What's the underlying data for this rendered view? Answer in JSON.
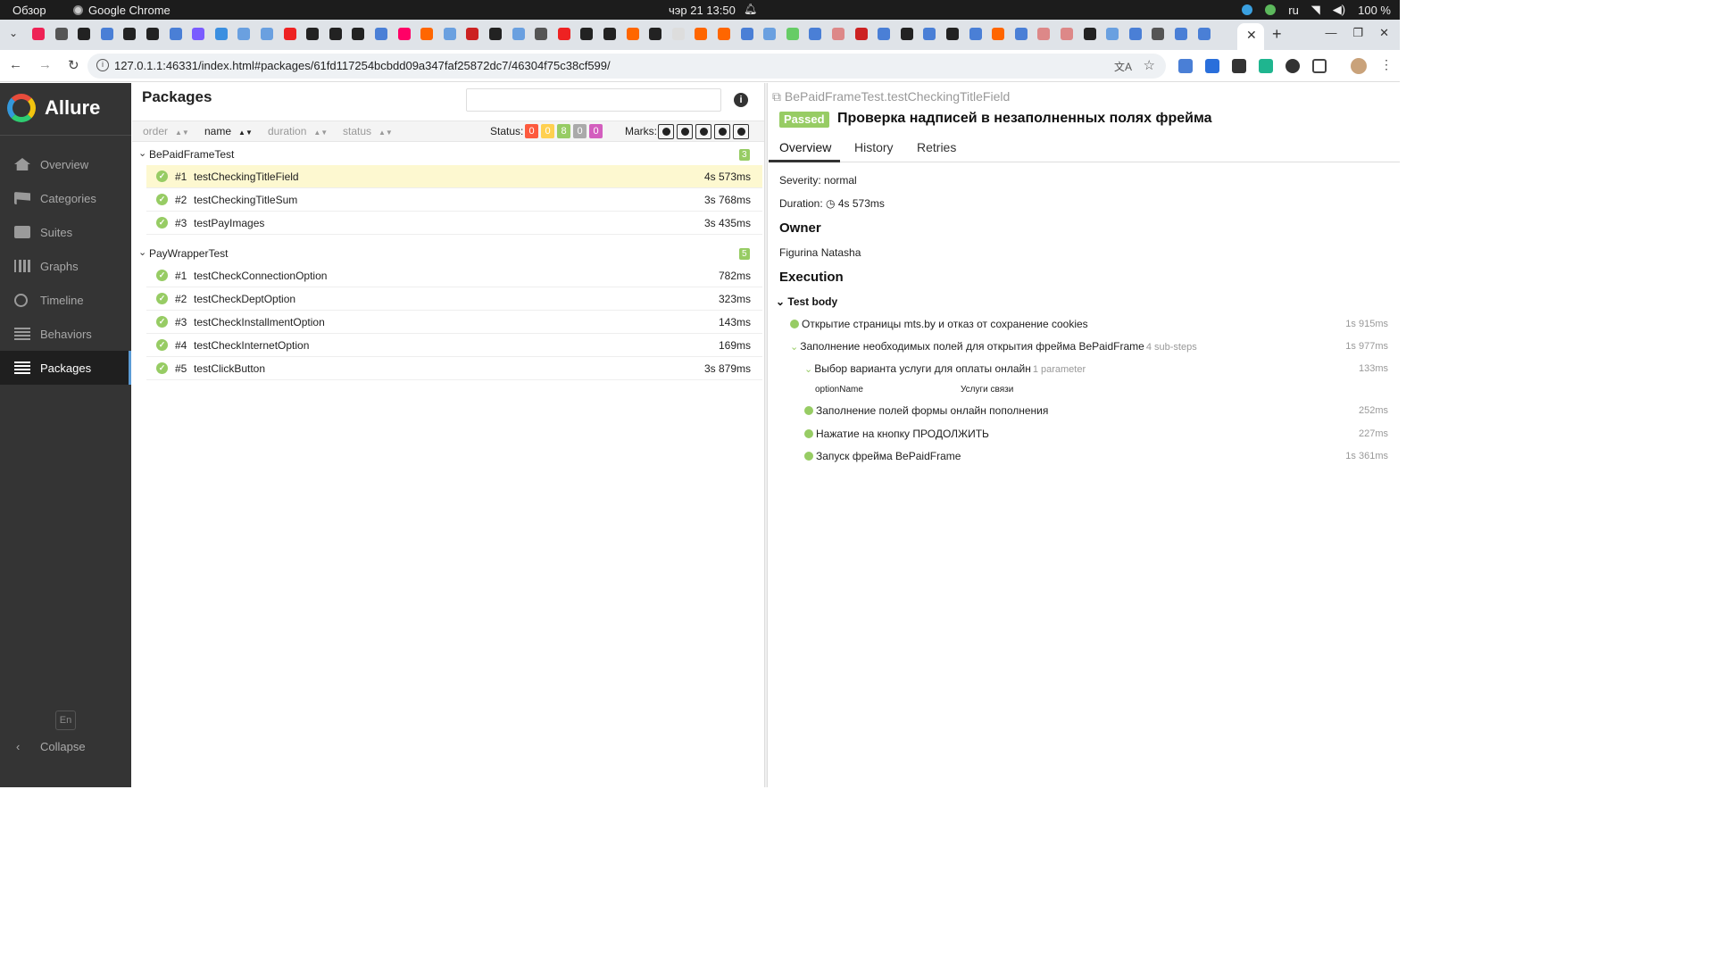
{
  "os": {
    "overview": "Обзор",
    "app_name": "Google Chrome",
    "clock": "чэр 21  13:50",
    "lang": "ru",
    "battery": "100 %"
  },
  "browser": {
    "url": "127.0.1.1:46331/index.html#packages/61fd117254bcbdd09a347faf25872dc7/46304f75c38cf599/"
  },
  "sidebar": {
    "brand": "Allure",
    "items": [
      {
        "label": "Overview",
        "icon": "home-icon"
      },
      {
        "label": "Categories",
        "icon": "flag-icon"
      },
      {
        "label": "Suites",
        "icon": "briefcase-icon"
      },
      {
        "label": "Graphs",
        "icon": "bar-chart-icon"
      },
      {
        "label": "Timeline",
        "icon": "clock-icon"
      },
      {
        "label": "Behaviors",
        "icon": "list-icon"
      },
      {
        "label": "Packages",
        "icon": "align-left-icon",
        "active": true
      }
    ],
    "language": "En",
    "collapse": "Collapse"
  },
  "packages": {
    "title": "Packages",
    "sort": {
      "order": "order",
      "name": "name",
      "duration": "duration",
      "status": "status"
    },
    "status_label": "Status:",
    "status_counts": [
      {
        "value": "0",
        "color": "#fd5a3e"
      },
      {
        "value": "0",
        "color": "#ffd050"
      },
      {
        "value": "8",
        "color": "#97cc64"
      },
      {
        "value": "0",
        "color": "#aaaaaa"
      },
      {
        "value": "0",
        "color": "#d35ebe"
      }
    ],
    "marks_label": "Marks:",
    "groups": [
      {
        "name": "BePaidFrameTest",
        "count": "3",
        "tests": [
          {
            "num": "#1",
            "name": "testCheckingTitleField",
            "duration": "4s 573ms",
            "selected": true
          },
          {
            "num": "#2",
            "name": "testCheckingTitleSum",
            "duration": "3s 768ms"
          },
          {
            "num": "#3",
            "name": "testPayImages",
            "duration": "3s 435ms"
          }
        ]
      },
      {
        "name": "PayWrapperTest",
        "count": "5",
        "tests": [
          {
            "num": "#1",
            "name": "testCheckConnectionOption",
            "duration": "782ms"
          },
          {
            "num": "#2",
            "name": "testCheckDeptOption",
            "duration": "323ms"
          },
          {
            "num": "#3",
            "name": "testCheckInstallmentOption",
            "duration": "143ms"
          },
          {
            "num": "#4",
            "name": "testCheckInternetOption",
            "duration": "169ms"
          },
          {
            "num": "#5",
            "name": "testClickButton",
            "duration": "3s 879ms"
          }
        ]
      }
    ]
  },
  "detail": {
    "fullname": "BePaidFrameTest.testCheckingTitleField",
    "status": "Passed",
    "title": "Проверка надписей в незаполненных полях фрейма",
    "tabs": [
      "Overview",
      "History",
      "Retries"
    ],
    "severity": "Severity: normal",
    "duration_label": "Duration:",
    "duration": "4s 573ms",
    "owner_heading": "Owner",
    "owner": "Figurina Natasha",
    "execution_heading": "Execution",
    "test_body": "Test body",
    "steps": {
      "s1": {
        "name": "Открытие страницы mts.by и отказ от сохранение cookies",
        "duration": "1s 915ms"
      },
      "s2": {
        "name": "Заполнение необходимых полей для открытия фрейма BePaidFrame",
        "sub": "4 sub-steps",
        "duration": "1s 977ms"
      },
      "s2a": {
        "name": "Выбор варианта услуги для оплаты онлайн",
        "sub": "1 parameter",
        "duration": "133ms"
      },
      "param": {
        "key": "optionName",
        "value": "Услуги связи"
      },
      "s2b": {
        "name": "Заполнение полей формы онлайн пополнения",
        "duration": "252ms"
      },
      "s2c": {
        "name": "Нажатие на кнопку ПРОДОЛЖИТЬ",
        "duration": "227ms"
      },
      "s2d": {
        "name": "Запуск фрейма BePaidFrame",
        "duration": "1s 361ms"
      }
    }
  }
}
